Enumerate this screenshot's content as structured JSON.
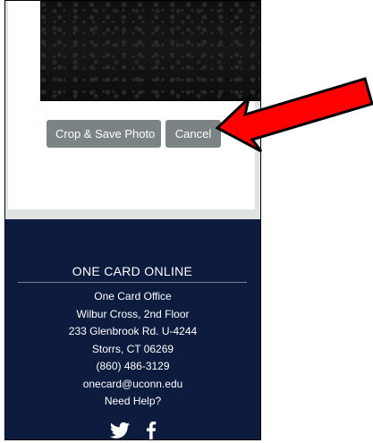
{
  "modal": {
    "crop_save_label": "Crop & Save Photo",
    "cancel_label": "Cancel"
  },
  "footer": {
    "title": "ONE CARD ONLINE",
    "lines": [
      "One Card Office",
      "Wilbur Cross, 2nd Floor",
      "233 Glenbrook Rd. U-4244",
      "Storrs, CT 06269",
      "(860) 486-3129",
      "onecard@uconn.edu",
      "Need Help?"
    ],
    "social": [
      "twitter-icon",
      "facebook-icon"
    ]
  },
  "annotation": {
    "arrow_color": "#ff0000",
    "arrow_target": "cancel-button"
  },
  "colors": {
    "footer_bg": "#0c1b3e",
    "button_bg": "#7c8385"
  }
}
